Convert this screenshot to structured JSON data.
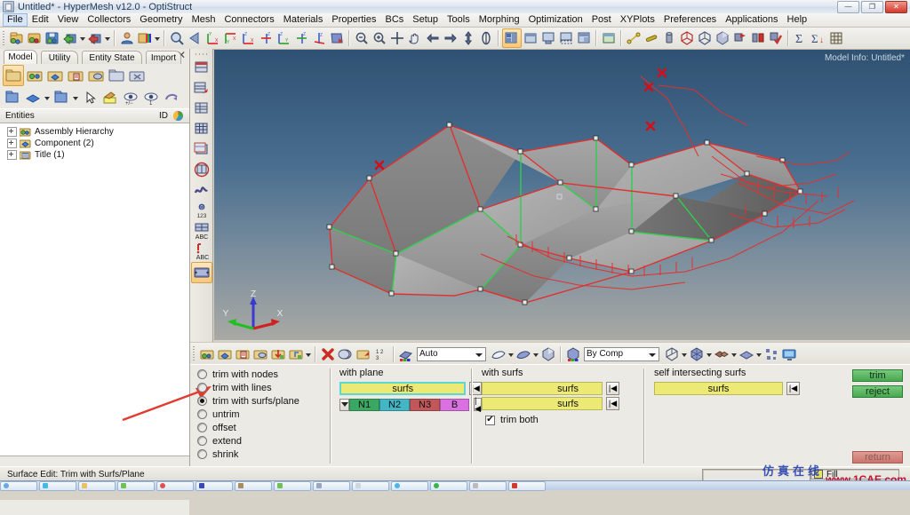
{
  "window": {
    "title": "Untitled* - HyperMesh v12.0 - OptiStruct",
    "minimize_label": "—",
    "maximize_label": "❐",
    "close_label": "✕"
  },
  "menubar": {
    "items": [
      {
        "label": "File",
        "active": true
      },
      {
        "label": "Edit"
      },
      {
        "label": "View"
      },
      {
        "label": "Collectors"
      },
      {
        "label": "Geometry"
      },
      {
        "label": "Mesh"
      },
      {
        "label": "Connectors"
      },
      {
        "label": "Materials"
      },
      {
        "label": "Properties"
      },
      {
        "label": "BCs"
      },
      {
        "label": "Setup"
      },
      {
        "label": "Tools"
      },
      {
        "label": "Morphing"
      },
      {
        "label": "Optimization"
      },
      {
        "label": "Post"
      },
      {
        "label": "XYPlots"
      },
      {
        "label": "Preferences"
      },
      {
        "label": "Applications"
      },
      {
        "label": "Help"
      }
    ]
  },
  "toolbar": {
    "groups": [
      {
        "icons": [
          "open-model-icon",
          "import-model-icon",
          "save-model-icon",
          "export-green-icon",
          "export-red-icon"
        ]
      },
      {
        "icons": [
          "user-profile-icon",
          "color-folder-icon"
        ]
      },
      {
        "icons": [
          "zoom-window-icon",
          "back-arrow-icon",
          "view-xy-icon",
          "view-yx-icon",
          "view-xz-icon",
          "view-zx-icon",
          "view-zy-icon",
          "view-yz-icon",
          "view-iso-icon",
          "shaded-view-icon"
        ]
      },
      {
        "icons": [
          "zoom-out-icon",
          "zoom-in-icon",
          "fit-view-icon",
          "pan-hand-icon",
          "rotate-left-icon",
          "rotate-right-icon",
          "rotate-updown-icon",
          "rotate-spin-icon"
        ]
      },
      {
        "icons": [
          "window-tile-icon",
          "window-new-icon",
          "window-save-icon",
          "window-capture-icon",
          "window-grab-icon"
        ]
      },
      {
        "icons": [
          "window-image-icon"
        ]
      },
      {
        "icons": [
          "node-line-icon",
          "line-icon",
          "solid-cyl-icon",
          "wire-box-icon",
          "shrink-box-icon",
          "shade-box-icon",
          "mask-flag-icon",
          "mirror-flag-icon",
          "flag-check-icon"
        ]
      },
      {
        "icons": [
          "summary-sigma-icon",
          "summary-sigma-sort-icon",
          "matrix-table-icon"
        ]
      }
    ]
  },
  "browser": {
    "tabs": [
      {
        "label": "Model",
        "active": true
      },
      {
        "label": "Utility",
        "active": false
      },
      {
        "label": "Entity State",
        "active": false
      },
      {
        "label": "Import",
        "active": false
      }
    ],
    "close_label": "✕",
    "toolbar_row1": [
      "folder-icon",
      "assembly-icon",
      "component-icon",
      "property-icon",
      "material-icon",
      "group-icon",
      "delete-folder-icon"
    ],
    "toolbar_row2": [
      "make-current-icon",
      "color-blue-icon",
      "display-folder-icon",
      "pointer-icon",
      "paint-icon",
      "visibility-plusminus-icon",
      "visibility-one-icon",
      "undo-visibility-icon"
    ],
    "header": {
      "entities_label": "Entities",
      "id_label": "ID",
      "color_label": "color-wheel-icon"
    },
    "tree": [
      {
        "label": "Assembly Hierarchy",
        "icon": "assembly-folder-icon"
      },
      {
        "label": "Component (2)",
        "icon": "component-folder-icon"
      },
      {
        "label": "Title (1)",
        "icon": "title-folder-icon"
      }
    ]
  },
  "vertical_toolbar": {
    "icons": [
      "geom-edit-icon",
      "geom-edit-red-icon",
      "geom-tool-icon",
      "mesh-grid-icon",
      "mesh-edit-icon",
      "mesh-circle-icon",
      "morph-icon",
      "number-123-icon",
      "abc-blue-icon",
      "abc-red-icon",
      "panel-page-icon"
    ],
    "selected_index": 10
  },
  "viewport": {
    "model_info": "Model Info: Untitled*",
    "watermark": "1CAE.COM",
    "axis": {
      "x": "X",
      "y": "Y",
      "z": "Z"
    }
  },
  "toolbar2": {
    "left_icons": [
      "collector-icon",
      "component-blue-icon",
      "property-icon",
      "material-icon",
      "load-collector-icon",
      "system-collector-icon"
    ],
    "mid_icons": [
      "delete-icon",
      "mask-icon",
      "find-icon",
      "renumber-123-icon"
    ],
    "auto_label": "Auto",
    "shape_icons": [
      "surf-auto-icon",
      "surf-shade-icon",
      "surf-solid-icon",
      "element-box-icon"
    ],
    "bycomp_label": "By Comp",
    "right_icons": [
      "wire-cube-icon",
      "mesh-cube-icon",
      "shrink-elem-icon",
      "shaded-elem-icon",
      "feature-icon",
      "display-monitor-icon"
    ]
  },
  "panel": {
    "title": "Surface Edit: Trim with Surfs/Plane",
    "mode_options": [
      {
        "label": "trim with nodes",
        "selected": false
      },
      {
        "label": "trim with lines",
        "selected": false
      },
      {
        "label": "trim with surfs/plane",
        "selected": true
      },
      {
        "label": "untrim",
        "selected": false
      },
      {
        "label": "offset",
        "selected": false
      },
      {
        "label": "extend",
        "selected": false
      },
      {
        "label": "shrink",
        "selected": false
      }
    ],
    "with_plane": {
      "header": "with plane",
      "surfs_label": "surfs",
      "back_label": "|◀",
      "node_buttons": [
        {
          "label": "N1",
          "color": "#3aa862"
        },
        {
          "label": "N2",
          "color": "#42b6c4"
        },
        {
          "label": "N3",
          "color": "#c1575a"
        },
        {
          "label": "B",
          "color": "#d971e0"
        }
      ]
    },
    "with_surfs": {
      "header": "with surfs",
      "surfs_label_1": "surfs",
      "surfs_label_2": "surfs",
      "back_label": "|◀",
      "trim_both_label": "trim both",
      "trim_both_checked": true,
      "check_glyph": "✔"
    },
    "self_intersecting": {
      "header": "self intersecting surfs",
      "surfs_label": "surfs",
      "back_label": "|◀"
    },
    "actions": {
      "trim_label": "trim",
      "reject_label": "reject",
      "return_label": "return"
    }
  },
  "statusbar": {
    "message": "Surface Edit: Trim with Surfs/Plane",
    "fill_label": "Fill"
  },
  "branding": {
    "cn_text": "仿真在线",
    "url_text": "www.1CAE.com"
  },
  "colors": {
    "accent_yellow": "#ecea75",
    "selection_cyan": "#5fd6cf",
    "trim_green": "#47a84f",
    "reject_red": "#c9756c",
    "viewport_top": "#2f5172",
    "viewport_bottom": "#a9a9a4",
    "edge_red": "#e03030",
    "edge_green": "#2fd04a",
    "surface_grey": "#9a9a9a"
  }
}
